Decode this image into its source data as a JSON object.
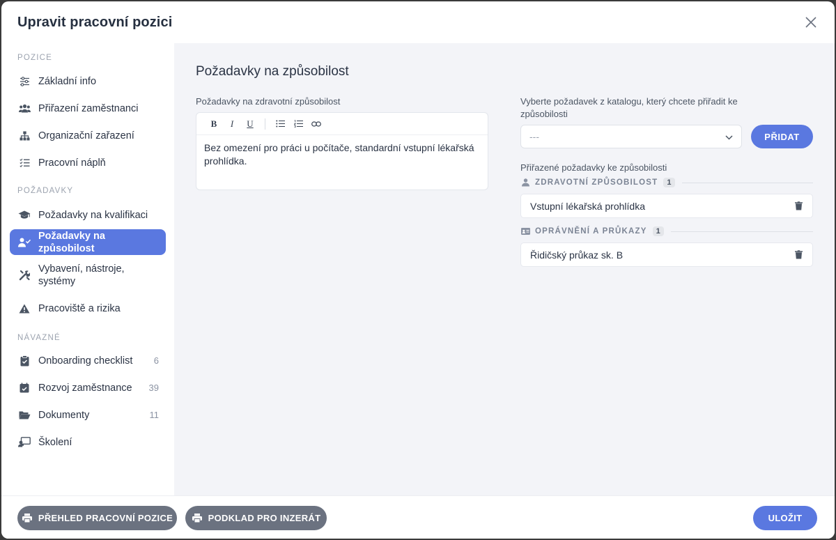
{
  "modal": {
    "title": "Upravit pracovní pozici"
  },
  "sidebar": {
    "sections": [
      {
        "label": "POZICE",
        "items": [
          {
            "label": "Základní info",
            "icon": "sliders-icon",
            "count": ""
          },
          {
            "label": "Přiřazení zaměstnanci",
            "icon": "users-icon",
            "count": ""
          },
          {
            "label": "Organizační zařazení",
            "icon": "sitemap-icon",
            "count": ""
          },
          {
            "label": "Pracovní náplň",
            "icon": "checklist-icon",
            "count": ""
          }
        ]
      },
      {
        "label": "POŽADAVKY",
        "items": [
          {
            "label": "Požadavky na kvalifikaci",
            "icon": "graduation-cap-icon",
            "count": ""
          },
          {
            "label": "Požadavky na způsobilost",
            "icon": "user-check-icon",
            "count": "",
            "active": true
          },
          {
            "label": "Vybavení, nástroje, systémy",
            "icon": "tools-icon",
            "count": ""
          },
          {
            "label": "Pracoviště a rizika",
            "icon": "warning-icon",
            "count": ""
          }
        ]
      },
      {
        "label": "NÁVAZNÉ",
        "items": [
          {
            "label": "Onboarding checklist",
            "icon": "clipboard-check-icon",
            "count": "6"
          },
          {
            "label": "Rozvoj zaměstnance",
            "icon": "calendar-check-icon",
            "count": "39"
          },
          {
            "label": "Dokumenty",
            "icon": "folder-open-icon",
            "count": "11"
          },
          {
            "label": "Školení",
            "icon": "teacher-icon",
            "count": ""
          }
        ]
      }
    ]
  },
  "content": {
    "heading": "Požadavky na způsobilost",
    "health_label": "Požadavky na zdravotní způsobilost",
    "editor_text": "Bez omezení pro práci u počítače, standardní vstupní lékařská prohlídka.",
    "catalog_label": "Vyberte požadavek z katalogu, který chcete přiřadit ke způsobilosti",
    "select_value": "---",
    "add_label": "PŘIDAT",
    "assigned_label": "Přiřazené požadavky ke způsobilosti",
    "groups": [
      {
        "title": "ZDRAVOTNÍ ZPŮSOBILOST",
        "count": "1",
        "icon": "user-icon",
        "items": [
          "Vstupní lékařská prohlídka"
        ]
      },
      {
        "title": "OPRÁVNĚNÍ A PRŮKAZY",
        "count": "1",
        "icon": "id-card-icon",
        "items": [
          "Řidičský průkaz sk. B"
        ]
      }
    ]
  },
  "footer": {
    "overview_label": "PŘEHLED PRACOVNÍ POZICE",
    "ad_label": "PODKLAD PRO INZERÁT",
    "save_label": "ULOŽIT"
  },
  "colors": {
    "accent": "#5a78e0",
    "gray_button": "#6b7280",
    "content_bg": "#f3f4f8"
  }
}
